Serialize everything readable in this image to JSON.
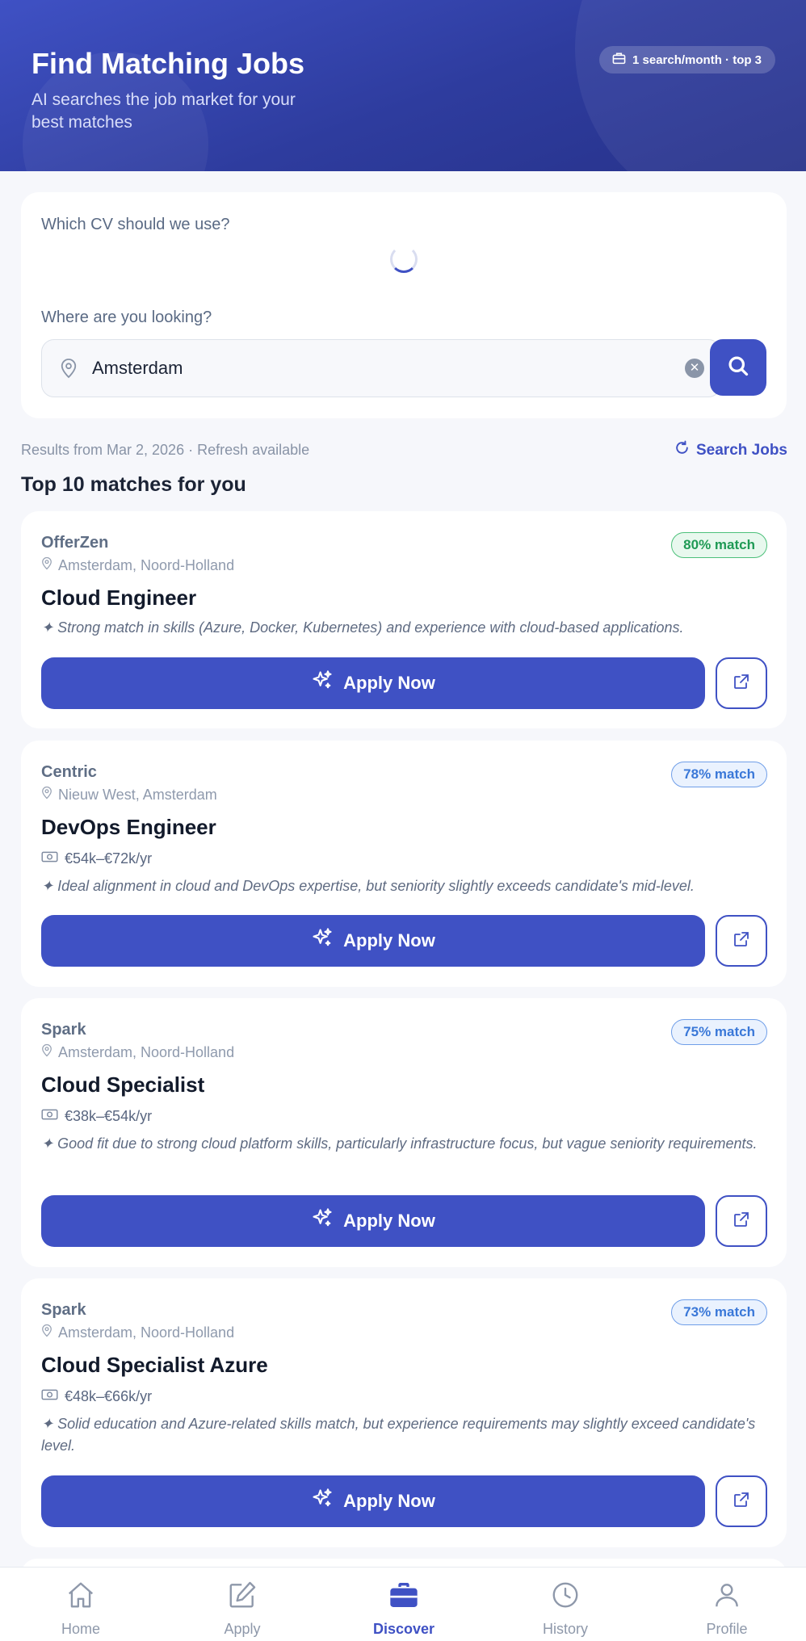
{
  "header": {
    "title": "Find Matching Jobs",
    "subtitle": "AI searches the job market for your best matches",
    "quota_badge": "1 search/month · top 3"
  },
  "search": {
    "cv_label": "Which CV should we use?",
    "location_label": "Where are you looking?",
    "location_value": "Amsterdam",
    "clear_symbol": "✕"
  },
  "results": {
    "meta": "Results from Mar 2, 2026 · Refresh available",
    "refresh_label": "Search Jobs",
    "heading": "Top 10 matches for you"
  },
  "jobs": [
    {
      "company": "OfferZen",
      "location": "Amsterdam, Noord-Holland",
      "match": "80% match",
      "title": "Cloud Engineer",
      "salary": "",
      "reason": "✦ Strong match in skills (Azure, Docker, Kubernetes) and experience with cloud-based applications.",
      "apply_label": "Apply Now"
    },
    {
      "company": "Centric",
      "location": "Nieuw West, Amsterdam",
      "match": "78% match",
      "title": "DevOps Engineer",
      "salary": "€54k–€72k/yr",
      "reason": "✦ Ideal alignment in cloud and DevOps expertise, but seniority slightly exceeds candidate's mid-level.",
      "apply_label": "Apply Now"
    },
    {
      "company": "Spark",
      "location": "Amsterdam, Noord-Holland",
      "match": "75% match",
      "title": "Cloud Specialist",
      "salary": "€38k–€54k/yr",
      "reason": "✦ Good fit due to strong cloud platform skills, particularly infrastructure focus, but vague seniority requirements.",
      "apply_label": "Apply Now"
    },
    {
      "company": "Spark",
      "location": "Amsterdam, Noord-Holland",
      "match": "73% match",
      "title": "Cloud Specialist Azure",
      "salary": "€48k–€66k/yr",
      "reason": "✦ Solid education and Azure-related skills match, but experience requirements may slightly exceed candidate's level.",
      "apply_label": "Apply Now"
    }
  ],
  "nav": {
    "items": [
      {
        "label": "Home",
        "icon": "home-icon"
      },
      {
        "label": "Apply",
        "icon": "edit-icon"
      },
      {
        "label": "Discover",
        "icon": "briefcase-icon"
      },
      {
        "label": "History",
        "icon": "clock-icon"
      },
      {
        "label": "Profile",
        "icon": "user-icon"
      }
    ],
    "active": "Discover"
  },
  "colors": {
    "primary": "#3f51c4",
    "header_start": "#3f51c4",
    "header_end": "#27328a",
    "badge_green": "#1f9a55",
    "badge_blue": "#3a78d8"
  }
}
